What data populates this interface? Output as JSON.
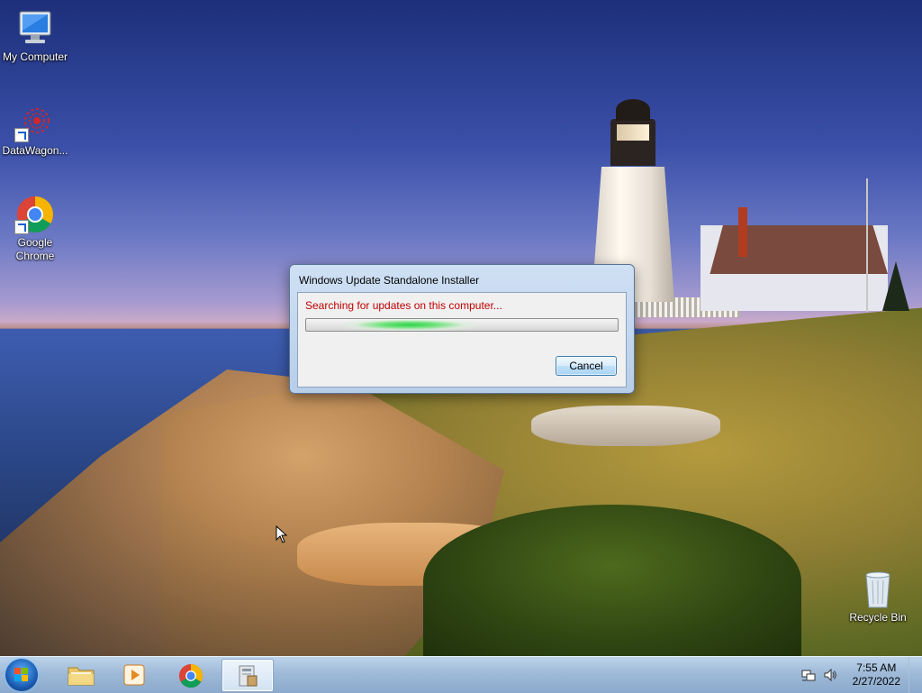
{
  "desktop": {
    "icons": [
      {
        "label": "My Computer"
      },
      {
        "label": "DataWagon..."
      },
      {
        "label": "Google Chrome"
      },
      {
        "label": "Recycle Bin"
      }
    ]
  },
  "dialog": {
    "title": "Windows Update Standalone Installer",
    "status": "Searching for updates on this computer...",
    "cancel_label": "Cancel"
  },
  "taskbar": {
    "pinned": [
      "start-orb",
      "windows-explorer-icon",
      "media-player-icon",
      "chrome-icon",
      "installer-icon"
    ],
    "clock": {
      "time": "7:55 AM",
      "date": "2/27/2022"
    },
    "tray": [
      "network-icon",
      "volume-icon"
    ]
  },
  "colors": {
    "status_text": "#c00000",
    "accent": "#1c5db3",
    "progress": "#2fd14a"
  }
}
